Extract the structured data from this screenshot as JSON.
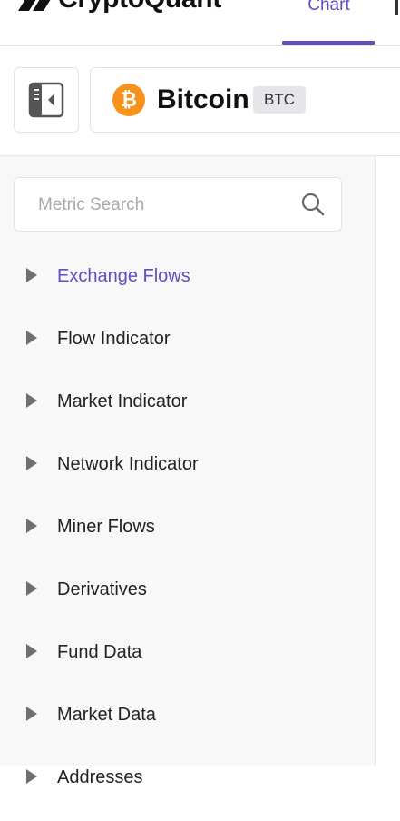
{
  "brand": {
    "name": "CryptoQuant"
  },
  "nav": {
    "tabs": [
      {
        "label": "Chart",
        "active": true
      }
    ]
  },
  "asset": {
    "name": "Bitcoin",
    "ticker": "BTC",
    "icon": "bitcoin-icon",
    "icon_color": "#f7931a"
  },
  "search": {
    "placeholder": "Metric Search"
  },
  "menu": {
    "items": [
      {
        "label": "Exchange Flows",
        "active": true
      },
      {
        "label": "Flow Indicator"
      },
      {
        "label": "Market Indicator"
      },
      {
        "label": "Network Indicator"
      },
      {
        "label": "Miner Flows"
      },
      {
        "label": "Derivatives"
      },
      {
        "label": "Fund Data"
      },
      {
        "label": "Market Data"
      },
      {
        "label": "Addresses"
      }
    ]
  },
  "colors": {
    "accent": "#5d4fc4",
    "bitcoin": "#f7931a"
  }
}
